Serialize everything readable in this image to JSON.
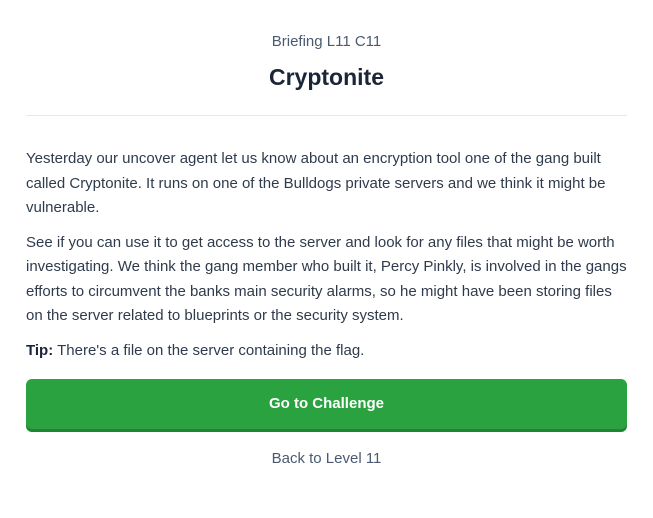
{
  "header": {
    "subtitle": "Briefing L11 C11",
    "title": "Cryptonite"
  },
  "briefing": {
    "paragraph_1": "Yesterday our uncover agent let us know about an encryption tool one of the gang built called Cryptonite. It runs on one of the Bulldogs private servers and we think it might be vulnerable.",
    "paragraph_2": "See if you can use it to get access to the server and look for any files that might be worth investigating. We think the gang member who built it, Percy Pinkly, is involved in the gangs efforts to circumvent the banks main security alarms, so he might have been storing files on the server related to blueprints or the security system.",
    "tip_label": "Tip:",
    "tip_text": " There's a file on the server containing the flag."
  },
  "actions": {
    "challenge_label": "Go to Challenge",
    "back_label": "Back to Level 11"
  },
  "colors": {
    "accent": "#2aa23f",
    "title": "#1a2638",
    "text": "#2f3b4c"
  }
}
